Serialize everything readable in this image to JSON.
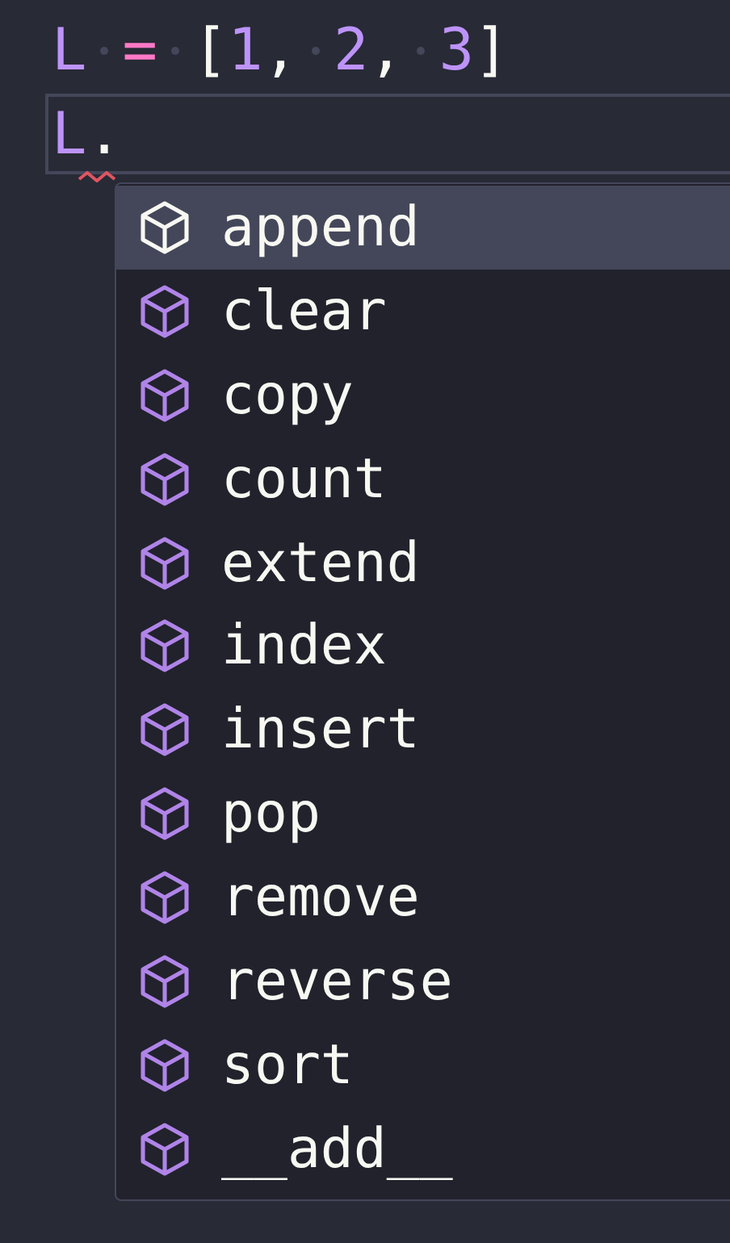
{
  "editor": {
    "lines": [
      {
        "current": false,
        "tokens": [
          {
            "kind": "variable",
            "text": "L"
          },
          {
            "kind": "space"
          },
          {
            "kind": "operator",
            "text": "="
          },
          {
            "kind": "space"
          },
          {
            "kind": "punct",
            "text": "["
          },
          {
            "kind": "number",
            "text": "1"
          },
          {
            "kind": "punct",
            "text": ","
          },
          {
            "kind": "space"
          },
          {
            "kind": "number",
            "text": "2"
          },
          {
            "kind": "punct",
            "text": ","
          },
          {
            "kind": "space"
          },
          {
            "kind": "number",
            "text": "3"
          },
          {
            "kind": "punct",
            "text": "]"
          }
        ]
      },
      {
        "current": true,
        "tokens": [
          {
            "kind": "variable",
            "text": "L"
          },
          {
            "kind": "punct",
            "text": ".",
            "error": true
          }
        ]
      }
    ]
  },
  "suggestions": [
    {
      "label": "append",
      "selected": true
    },
    {
      "label": "clear",
      "selected": false
    },
    {
      "label": "copy",
      "selected": false
    },
    {
      "label": "count",
      "selected": false
    },
    {
      "label": "extend",
      "selected": false
    },
    {
      "label": "index",
      "selected": false
    },
    {
      "label": "insert",
      "selected": false
    },
    {
      "label": "pop",
      "selected": false
    },
    {
      "label": "remove",
      "selected": false
    },
    {
      "label": "reverse",
      "selected": false
    },
    {
      "label": "sort",
      "selected": false
    },
    {
      "label": "__add__",
      "selected": false
    }
  ]
}
